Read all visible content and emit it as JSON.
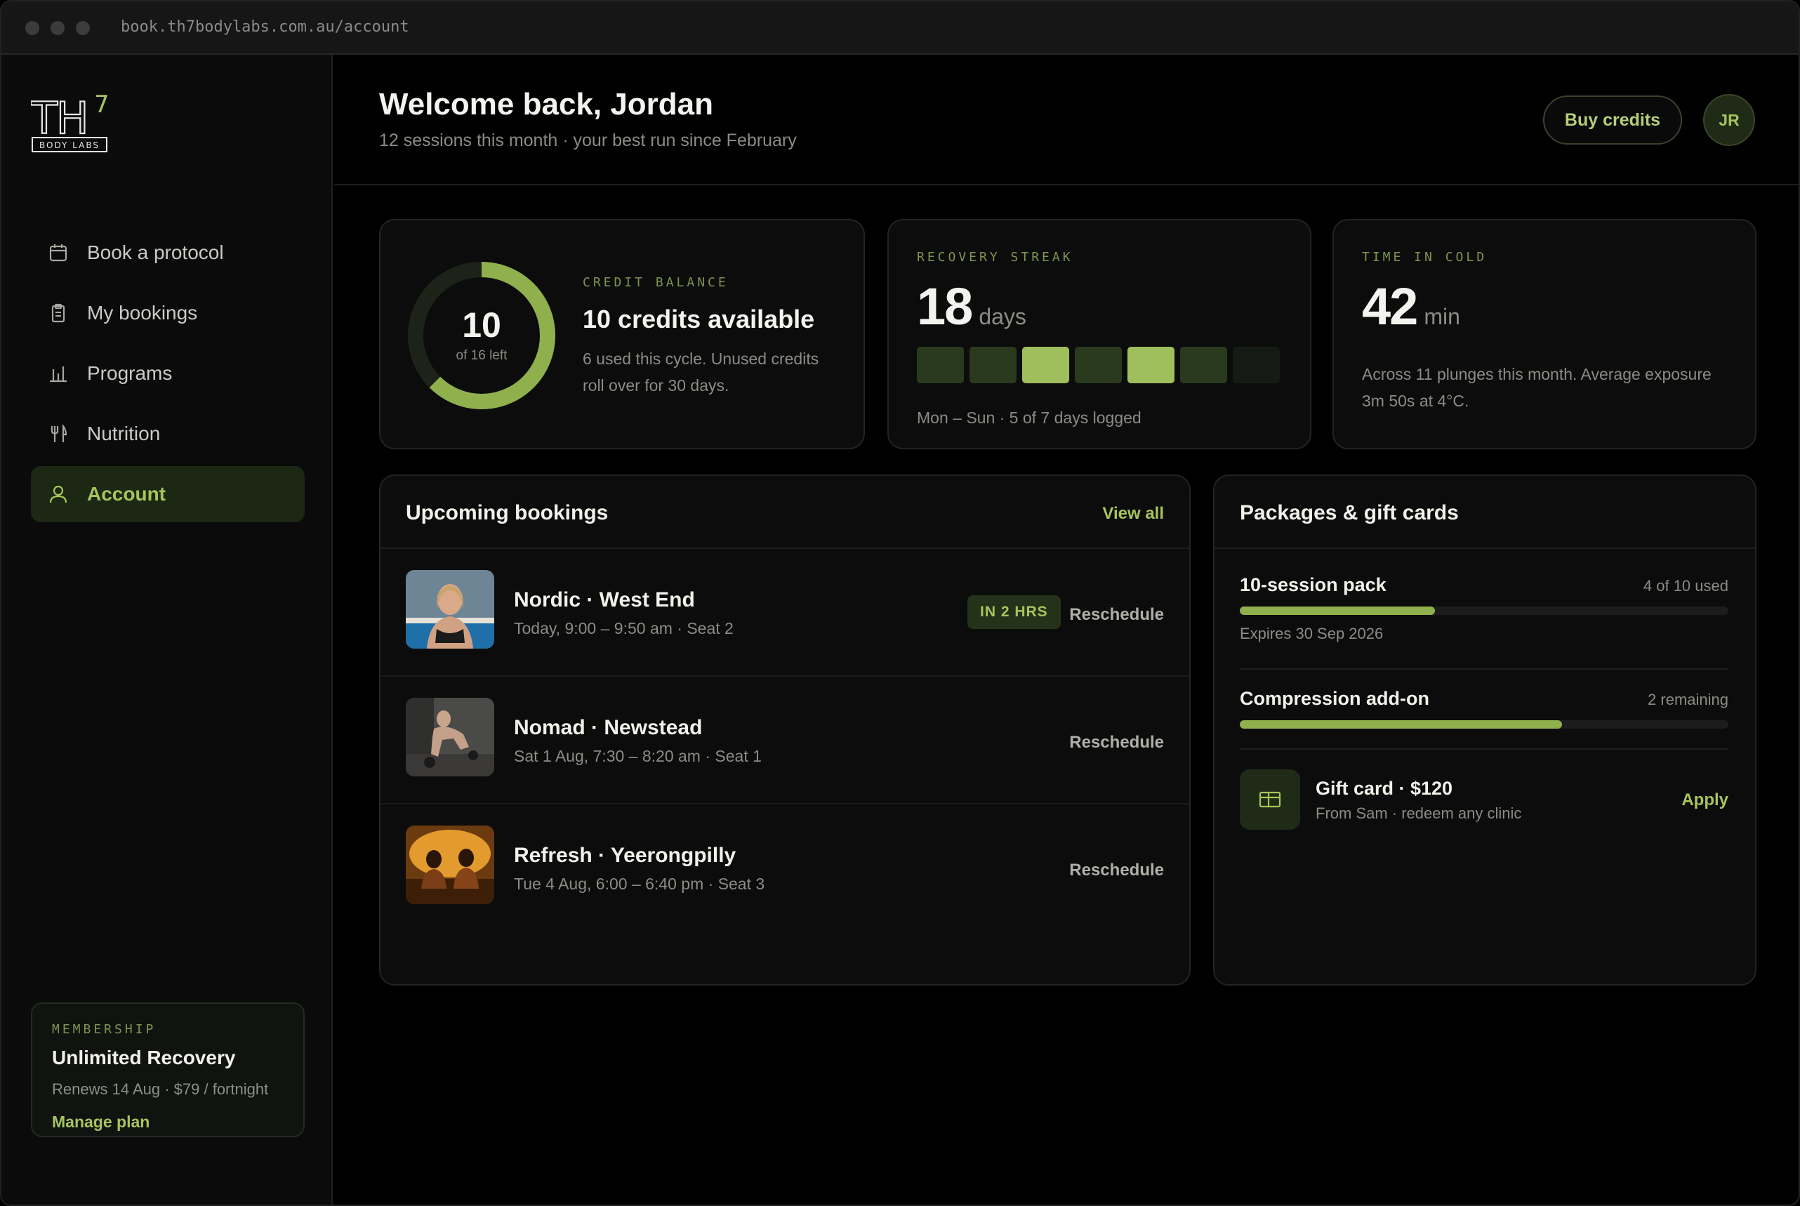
{
  "browser": {
    "url": "book.th7bodylabs.com.au/account"
  },
  "brand": {
    "logo_text": "TH7",
    "logo_sub": "BODY LABS"
  },
  "sidebar": {
    "items": [
      {
        "label": "Book a protocol",
        "icon": "calendar-icon"
      },
      {
        "label": "My bookings",
        "icon": "clipboard-icon"
      },
      {
        "label": "Programs",
        "icon": "bar-chart-icon"
      },
      {
        "label": "Nutrition",
        "icon": "utensils-icon"
      },
      {
        "label": "Account",
        "icon": "user-icon",
        "active": true
      }
    ],
    "membership": {
      "eyebrow": "MEMBERSHIP",
      "title": "Unlimited Recovery",
      "renews": "Renews 14 Aug · $79 / fortnight",
      "link": "Manage plan"
    }
  },
  "header": {
    "title": "Welcome back, Jordan",
    "subtitle": "12 sessions this month · your best run since February",
    "buy_label": "Buy credits",
    "avatar_initials": "JR"
  },
  "credits": {
    "eyebrow": "CREDIT BALANCE",
    "ring_value": "10",
    "ring_sub": "of 16 left",
    "remaining": 10,
    "total": 16,
    "title": "10 credits available",
    "desc": "6 used this cycle. Unused credits roll over for 30 days."
  },
  "streak": {
    "eyebrow": "RECOVERY STREAK",
    "value": "18",
    "unit": "days",
    "days_intensity": [
      1,
      1,
      3,
      1,
      3,
      1,
      0
    ],
    "caption": "Mon – Sun · 5 of 7 days logged"
  },
  "cold": {
    "eyebrow": "TIME IN COLD",
    "value": "42",
    "unit": "min",
    "desc": "Across 11 plunges this month. Average exposure 3m 50s at 4°C."
  },
  "bookings": {
    "title": "Upcoming bookings",
    "view_all": "View all",
    "items": [
      {
        "title": "Nordic · West End",
        "sub": "Today, 9:00 – 9:50 am · Seat 2",
        "badge": "IN 2 HRS",
        "action": "Reschedule"
      },
      {
        "title": "Nomad · Newstead",
        "sub": "Sat 1 Aug, 7:30 – 8:20 am · Seat 1",
        "action": "Reschedule"
      },
      {
        "title": "Refresh · Yeerongpilly",
        "sub": "Tue 4 Aug, 6:00 – 6:40 pm · Seat 3",
        "action": "Reschedule"
      }
    ]
  },
  "packages": {
    "title": "Packages & gift cards",
    "items": [
      {
        "title": "10-session pack",
        "meta": "4 of 10 used",
        "progress": 0.4,
        "expires": "Expires 30 Sep 2026"
      },
      {
        "title": "Compression add-on",
        "meta": "2 remaining",
        "progress": 0.66
      }
    ],
    "gift": {
      "title": "Gift card · $120",
      "sub": "From Sam · redeem any clinic",
      "action": "Apply",
      "icon": "gift-card-icon"
    }
  },
  "colors": {
    "accent": "#a7c45c",
    "accent_dark": "#1c2714",
    "bg": "#000000",
    "card": "#0c0c0c"
  }
}
